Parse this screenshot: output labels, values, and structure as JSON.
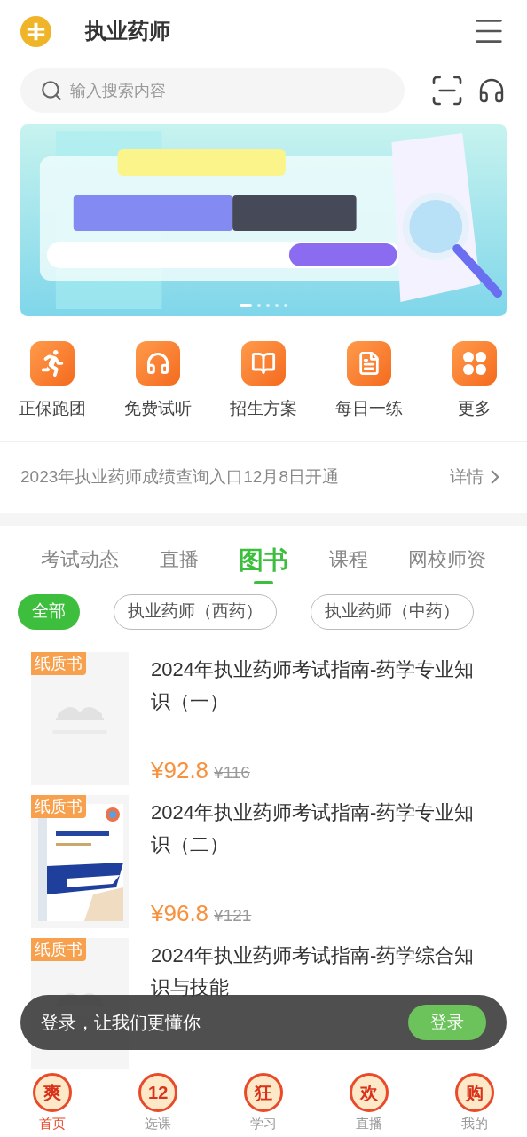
{
  "header": {
    "title": "执业药师"
  },
  "search": {
    "placeholder": "输入搜索内容"
  },
  "banner": {
    "dots": [
      {
        "selected": true
      },
      {
        "selected": false
      },
      {
        "selected": false
      },
      {
        "selected": false
      },
      {
        "selected": false
      }
    ]
  },
  "shortcuts": [
    {
      "kind": "runner",
      "label": "正保跑团"
    },
    {
      "kind": "headphones",
      "label": "免费试听"
    },
    {
      "kind": "book",
      "label": "招生方案"
    },
    {
      "kind": "note",
      "label": "每日一练"
    },
    {
      "kind": "grid",
      "label": "更多"
    }
  ],
  "notice": {
    "text": "2023年执业药师成绩查询入口12月8日开通",
    "link": "详情"
  },
  "tabs": [
    {
      "label": "考试动态",
      "selected": false
    },
    {
      "label": "直播",
      "selected": false
    },
    {
      "label": "图书",
      "selected": true
    },
    {
      "label": "课程",
      "selected": false
    },
    {
      "label": "网校师资",
      "selected": false
    }
  ],
  "filters": [
    {
      "label": "全部",
      "selected": true
    },
    {
      "label": "执业药师（西药）",
      "selected": false
    },
    {
      "label": "执业药师（中药）",
      "selected": false
    }
  ],
  "books": [
    {
      "tag": "纸质书",
      "kind": "placeholder",
      "title": "2024年执业药师考试指南-药学专业知识（一）",
      "price": "¥92.8",
      "original_price": "¥116"
    },
    {
      "tag": "纸质书",
      "kind": "cover",
      "title": "2024年执业药师考试指南-药学专业知识（二）",
      "price": "¥96.8",
      "original_price": "¥121"
    },
    {
      "tag": "纸质书",
      "kind": "placeholder",
      "title": "2024年执业药师考试指南-药学综合知识与技能"
    }
  ],
  "toast": {
    "text": "登录，让我们更懂你",
    "button": "登录"
  },
  "nav": [
    {
      "badge": "爽",
      "label": "首页",
      "selected": true
    },
    {
      "badge": "12",
      "label": "选课",
      "selected": false
    },
    {
      "badge": "狂",
      "label": "学习",
      "selected": false
    },
    {
      "badge": "欢",
      "label": "直播",
      "selected": false
    },
    {
      "badge": "购",
      "label": "我的",
      "selected": false
    }
  ]
}
